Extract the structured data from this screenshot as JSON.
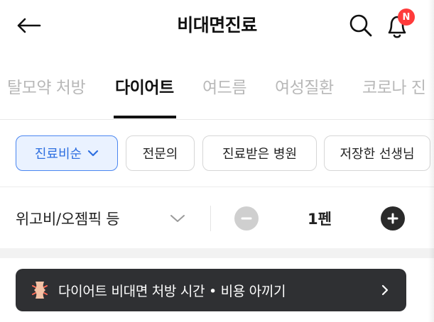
{
  "header": {
    "title": "비대면진료",
    "notification_badge": "N",
    "icons": {
      "back": "back-arrow-icon",
      "search": "search-icon",
      "bell": "bell-icon"
    }
  },
  "tabs": [
    {
      "label": "탈모약 처방",
      "active": false
    },
    {
      "label": "다이어트",
      "active": true
    },
    {
      "label": "여드름",
      "active": false
    },
    {
      "label": "여성질환",
      "active": false
    },
    {
      "label": "코로나 진",
      "active": false
    }
  ],
  "filters": [
    {
      "label": "진료비순",
      "selected": true,
      "has_dropdown": true
    },
    {
      "label": "전문의",
      "selected": false
    },
    {
      "label": "진료받은 병원",
      "selected": false
    },
    {
      "label": "저장한 선생님",
      "selected": false
    }
  ],
  "product": {
    "name": "위고비/오젬픽 등",
    "quantity": "1펜"
  },
  "banner": {
    "text": "다이어트 비대면 처방 시간 • 비용 아끼기",
    "icon": "body-figure-icon"
  },
  "colors": {
    "accent": "#2e6fe0",
    "chip_selected_bg": "#eaf2ff",
    "badge": "#ff3b3b",
    "banner_bg": "#2f3033"
  }
}
